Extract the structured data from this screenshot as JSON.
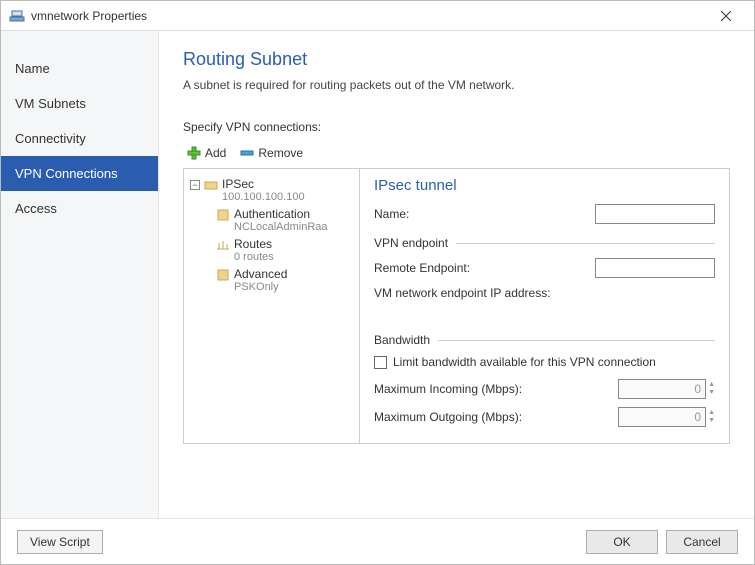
{
  "window": {
    "title": "vmnetwork Properties"
  },
  "sidebar": {
    "items": [
      {
        "label": "Name"
      },
      {
        "label": "VM Subnets"
      },
      {
        "label": "Connectivity"
      },
      {
        "label": "VPN Connections"
      },
      {
        "label": "Access"
      }
    ],
    "active_index": 3
  },
  "page": {
    "title": "Routing Subnet",
    "description": "A subnet is required for routing packets out of the VM network.",
    "specify_label": "Specify VPN connections:"
  },
  "toolbar": {
    "add": "Add",
    "remove": "Remove"
  },
  "tree": {
    "root": {
      "label": "IPSec",
      "sub": "100.100.100.100"
    },
    "children": [
      {
        "label": "Authentication",
        "sub": "NCLocalAdminRaa"
      },
      {
        "label": "Routes",
        "sub": "0 routes"
      },
      {
        "label": "Advanced",
        "sub": "PSKOnly"
      }
    ]
  },
  "detail": {
    "title": "IPsec tunnel",
    "name_label": "Name:",
    "name_value": "",
    "vpn_endpoint_group": "VPN endpoint",
    "remote_label": "Remote Endpoint:",
    "remote_value": "",
    "vm_endpoint_label": "VM network endpoint IP address:",
    "bandwidth_group": "Bandwidth",
    "limit_label": "Limit bandwidth available for this VPN connection",
    "max_in_label": "Maximum Incoming (Mbps):",
    "max_in_value": "0",
    "max_out_label": "Maximum Outgoing (Mbps):",
    "max_out_value": "0"
  },
  "footer": {
    "view_script": "View Script",
    "ok": "OK",
    "cancel": "Cancel"
  }
}
